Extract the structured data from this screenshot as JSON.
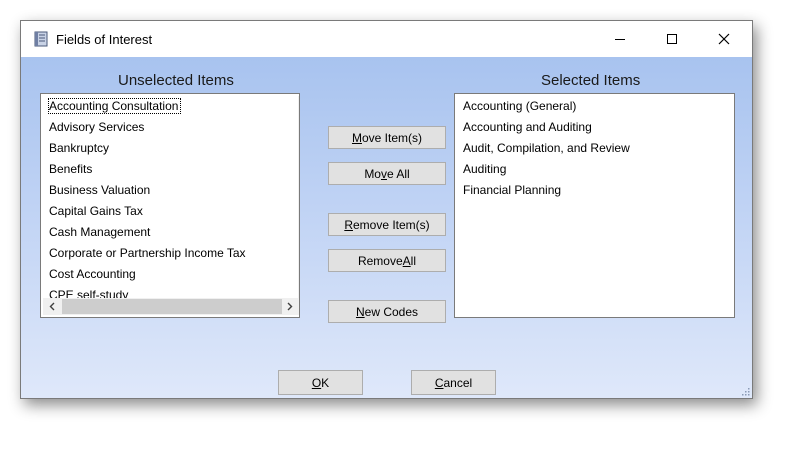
{
  "window": {
    "title": "Fields of Interest",
    "controls": {
      "minimize": "—",
      "maximize": "☐",
      "close": "✕"
    }
  },
  "unselected": {
    "heading": "Unselected Items",
    "items": [
      "Accounting Consultation",
      "Advisory Services",
      "Bankruptcy",
      "Benefits",
      "Business Valuation",
      "Capital Gains Tax",
      "Cash Management",
      "Corporate or Partnership Income Tax",
      "Cost Accounting",
      "CPE self-study"
    ]
  },
  "selected": {
    "heading": "Selected Items",
    "items": [
      "Accounting (General)",
      "Accounting and Auditing",
      "Audit, Compilation, and Review",
      "Auditing",
      "Financial Planning"
    ]
  },
  "buttons": {
    "move_items": {
      "pre": "",
      "key": "M",
      "post": "ove Item(s)"
    },
    "move_all": {
      "pre": "Mo",
      "key": "v",
      "post": "e All"
    },
    "remove_items": {
      "pre": "",
      "key": "R",
      "post": "emove Item(s)"
    },
    "remove_all": {
      "pre": "Remove ",
      "key": "A",
      "post": "ll"
    },
    "new_codes": {
      "pre": "",
      "key": "N",
      "post": "ew Codes"
    },
    "ok": {
      "pre": "",
      "key": "O",
      "post": "K"
    },
    "cancel": {
      "pre": "",
      "key": "C",
      "post": "ancel"
    }
  },
  "colors": {
    "client_gradient_top": "#a8c3ef",
    "client_gradient_bottom": "#dfe8fa",
    "button_face": "#e1e1e1"
  }
}
